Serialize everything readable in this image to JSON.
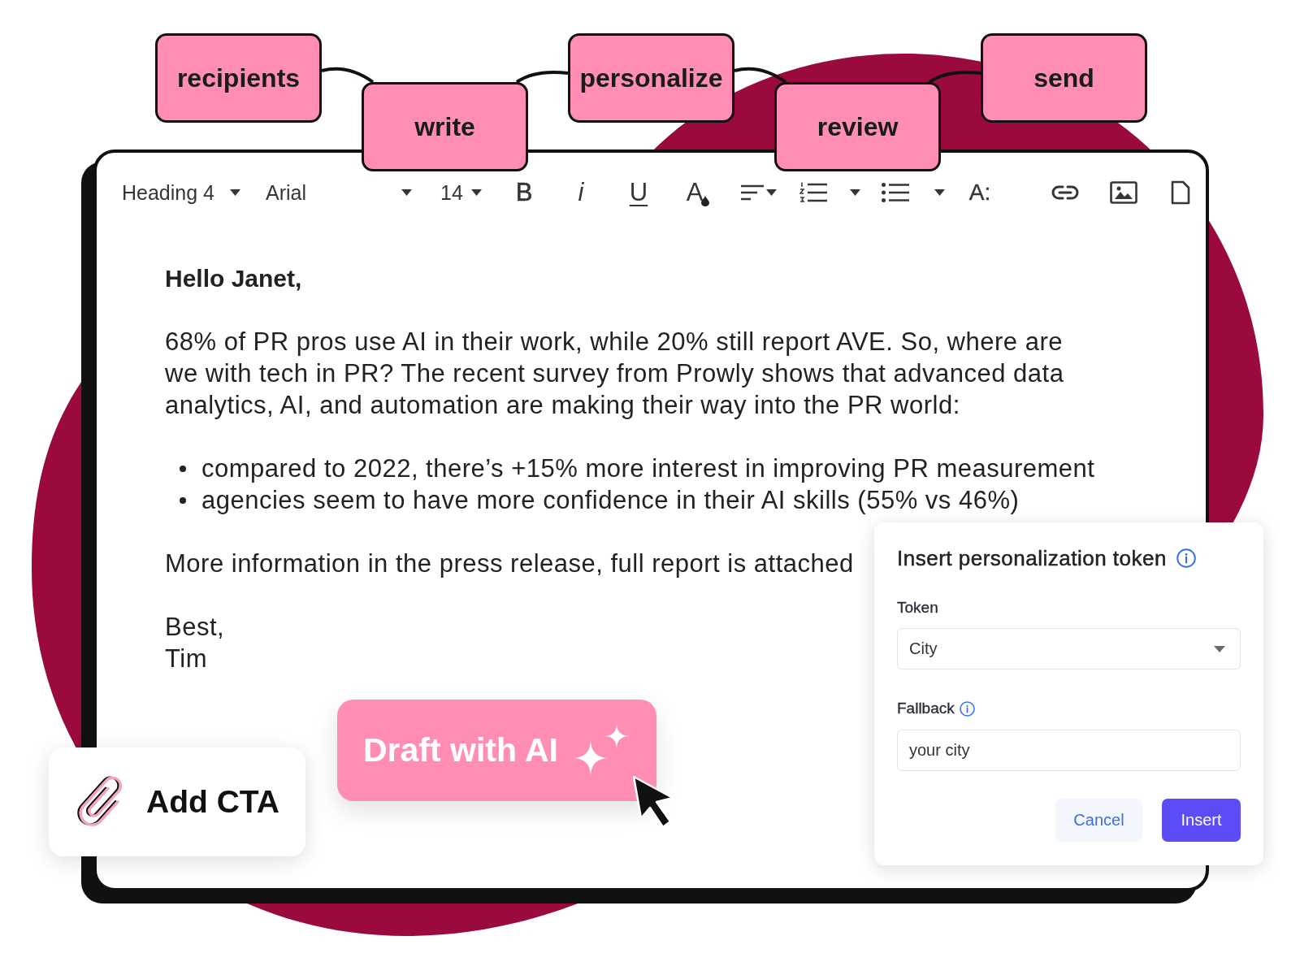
{
  "steps": [
    {
      "label": "recipients"
    },
    {
      "label": "write"
    },
    {
      "label": "personalize"
    },
    {
      "label": "review"
    },
    {
      "label": "send"
    }
  ],
  "editor": {
    "toolbar": {
      "style_dropdown": "Heading 4",
      "font_dropdown": "Arial",
      "size_dropdown": "14",
      "buttons": [
        {
          "kind": "bold",
          "label": "B"
        },
        {
          "kind": "italic",
          "label": "i"
        },
        {
          "kind": "underline",
          "label": "U"
        },
        {
          "kind": "text_color",
          "label": "A"
        },
        {
          "kind": "align"
        },
        {
          "kind": "numbered_list"
        },
        {
          "kind": "bullet_list"
        },
        {
          "kind": "text_size",
          "label": "A:"
        },
        {
          "kind": "link"
        },
        {
          "kind": "image"
        },
        {
          "kind": "document"
        }
      ]
    },
    "body": {
      "greeting": "Hello Janet,",
      "paragraph": "68% of PR pros use AI in their work, while 20% still report AVE. So, where are we with tech in PR? The recent survey from Prowly shows that advanced data analytics, AI, and automation are making their way into the PR world:",
      "bullets": [
        "compared to 2022, there’s +15% more interest in improving PR measurement",
        "agencies seem to have more confidence in their AI skills (55% vs 46%)"
      ],
      "closing": "More information in the press release, full report is attached",
      "sign_off": [
        "Best,",
        "Tim"
      ]
    }
  },
  "add_cta_button": {
    "label": "Add CTA"
  },
  "draft_ai_button": {
    "label": "Draft with AI"
  },
  "token_popup": {
    "title": "Insert personalization token",
    "token": {
      "label": "Token",
      "value": "City"
    },
    "fallback": {
      "label": "Fallback",
      "value": "your city"
    },
    "buttons": [
      {
        "kind": "secondary",
        "label": "Cancel"
      },
      {
        "kind": "primary",
        "label": "Insert"
      }
    ]
  }
}
